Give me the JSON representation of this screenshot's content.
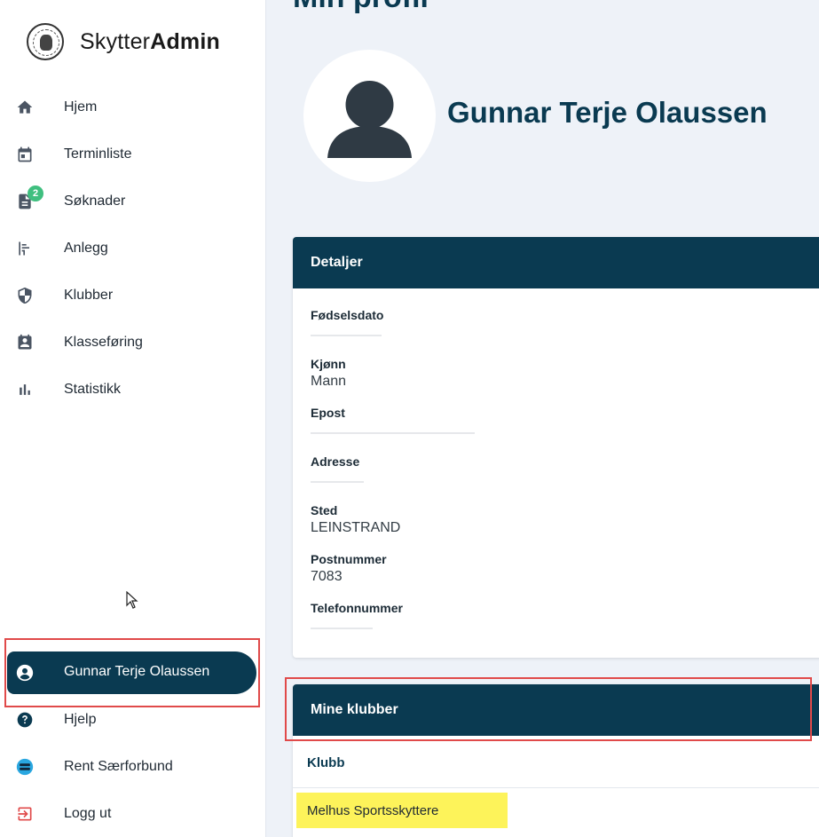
{
  "brand": {
    "name_light": "Skytter",
    "name_bold": "Admin"
  },
  "sidebar": {
    "items": [
      {
        "label": "Hjem",
        "icon": "home-icon"
      },
      {
        "label": "Terminliste",
        "icon": "calendar-icon"
      },
      {
        "label": "Søknader",
        "icon": "document-icon",
        "badge": "2"
      },
      {
        "label": "Anlegg",
        "icon": "range-icon"
      },
      {
        "label": "Klubber",
        "icon": "shield-icon"
      },
      {
        "label": "Klasseføring",
        "icon": "contact-card-icon"
      },
      {
        "label": "Statistikk",
        "icon": "bar-chart-icon"
      }
    ],
    "bottom_items": [
      {
        "label": "Gunnar Terje Olaussen",
        "icon": "account-icon"
      },
      {
        "label": "Hjelp",
        "icon": "help-icon"
      },
      {
        "label": "Rent Særforbund",
        "icon": "rent-logo-icon"
      },
      {
        "label": "Logg ut",
        "icon": "logout-icon"
      }
    ]
  },
  "main": {
    "page_title": "Min profil",
    "profile_name": "Gunnar Terje Olaussen",
    "details": {
      "header": "Detaljer",
      "fields": [
        {
          "label": "Fødselsdato",
          "value": ""
        },
        {
          "label": "Kjønn",
          "value": "Mann"
        },
        {
          "label": "Epost",
          "value": ""
        },
        {
          "label": "Adresse",
          "value": ""
        },
        {
          "label": "Sted",
          "value": "LEINSTRAND"
        },
        {
          "label": "Postnummer",
          "value": "7083"
        },
        {
          "label": "Telefonnummer",
          "value": ""
        }
      ]
    },
    "clubs": {
      "header": "Mine klubber",
      "column": "Klubb",
      "rows": [
        "Melhus Sportsskyttere"
      ]
    }
  },
  "colors": {
    "primary": "#0a3a51",
    "badge": "#3fbf7f",
    "highlight": "#fdf35a",
    "annotation": "#e04a4a",
    "background": "#eef2f8"
  }
}
